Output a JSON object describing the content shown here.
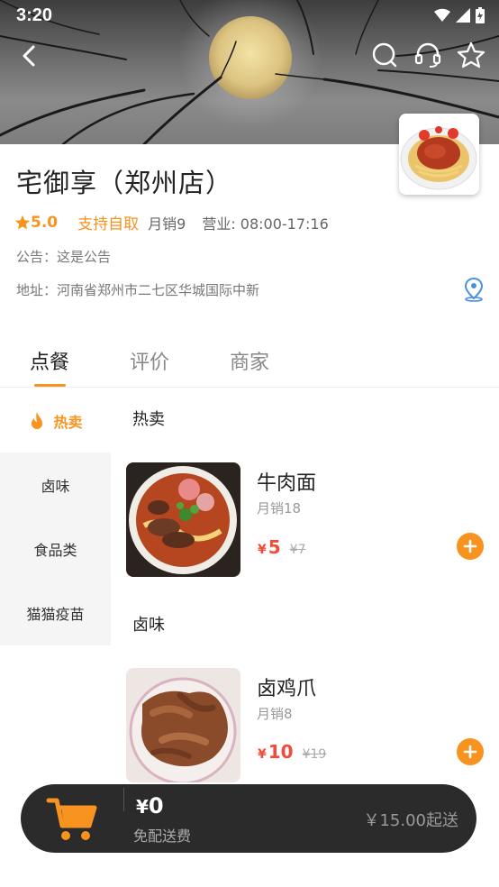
{
  "status_bar": {
    "time": "3:20"
  },
  "shop": {
    "name": "宅御享（郑州店）",
    "rating": "5.0",
    "pickup": "支持自取",
    "monthly_sales": "月销9",
    "hours": "营业: 08:00-17:16",
    "notice": "公告：这是公告",
    "address": "地址：河南省郑州市二七区华城国际中新"
  },
  "tabs": [
    {
      "label": "点餐",
      "active": true
    },
    {
      "label": "评价",
      "active": false
    },
    {
      "label": "商家",
      "active": false
    }
  ],
  "categories": {
    "hot": "热卖",
    "items": [
      "卤味",
      "食品类",
      "猫猫疫苗"
    ]
  },
  "sections": [
    {
      "title": "热卖",
      "product": {
        "name": "牛肉面",
        "sales": "月销18",
        "yen": "¥",
        "price": "5",
        "old_price": "¥7"
      }
    },
    {
      "title": "卤味",
      "product": {
        "name": "卤鸡爪",
        "sales": "月销8",
        "yen": "¥",
        "price": "10",
        "old_price": "¥19"
      }
    }
  ],
  "cart": {
    "yen": "¥",
    "total": "0",
    "delivery": "免配送费",
    "minimum": "￥15.00起送"
  },
  "colors": {
    "accent": "#f7931e",
    "price": "#f34b3a",
    "cart_bg": "#2b2b2b"
  },
  "icons": [
    "back-arrow-icon",
    "search-icon",
    "customer-service-icon",
    "star-icon",
    "map-pin-icon",
    "flame-icon",
    "plus-icon",
    "cart-icon"
  ]
}
